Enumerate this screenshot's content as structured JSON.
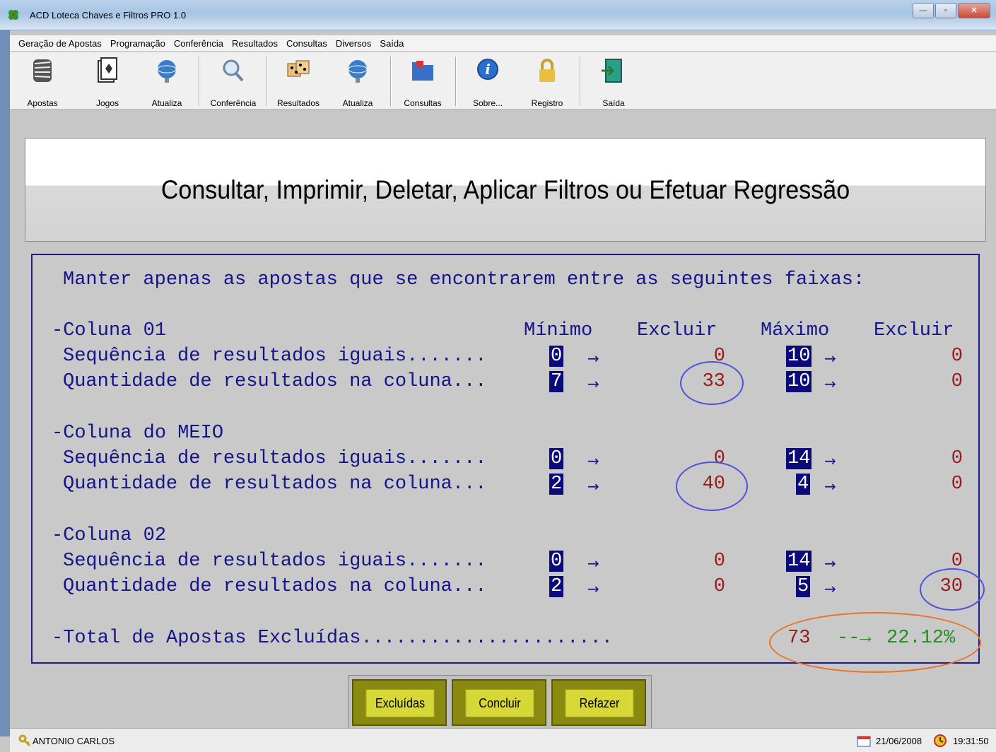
{
  "window": {
    "title": "ACD Loteca Chaves e Filtros PRO 1.0"
  },
  "menu": [
    "Geração de Apostas",
    "Programação",
    "Conferência",
    "Resultados",
    "Consultas",
    "Diversos",
    "Saída"
  ],
  "toolbar": {
    "apostas": "Apostas",
    "jogos": "Jogos",
    "atualiza1": "Atualiza",
    "conferencia": "Conferência",
    "resultados": "Resultados",
    "atualiza2": "Atualiza",
    "consultas": "Consultas",
    "sobre": "Sobre...",
    "registro": "Registro",
    "saida": "Saída"
  },
  "header": {
    "title": "Consultar, Imprimir, Deletar, Aplicar Filtros ou Efetuar Regressão"
  },
  "filter": {
    "intro": "Manter apenas as apostas que se encontrarem entre as seguintes faixas:",
    "col_min": "Mínimo",
    "col_excl": "Excluir",
    "col_max": "Máximo",
    "col_excl2": "Excluir",
    "row_seq": "Sequência de resultados iguais.......",
    "row_qty": "Quantidade de resultados na coluna...",
    "sections": [
      {
        "label": "-Coluna 01",
        "seq": {
          "min": "0",
          "excl_min": "0",
          "max": "10",
          "excl_max": "0"
        },
        "qty": {
          "min": "7",
          "excl_min": "33",
          "max": "10",
          "excl_max": "0"
        }
      },
      {
        "label": "-Coluna do MEIO",
        "seq": {
          "min": "0",
          "excl_min": "0",
          "max": "14",
          "excl_max": "0"
        },
        "qty": {
          "min": "2",
          "excl_min": "40",
          "max": "4",
          "excl_max": "0"
        }
      },
      {
        "label": "-Coluna 02",
        "seq": {
          "min": "0",
          "excl_min": "0",
          "max": "14",
          "excl_max": "0"
        },
        "qty": {
          "min": "2",
          "excl_min": "0",
          "max": "5",
          "excl_max": "30"
        }
      }
    ],
    "total_label": "-Total de Apostas Excluídas......................",
    "total_value": "73",
    "total_pct": "22.12%"
  },
  "buttons": {
    "excluidas": "Excluídas",
    "concluir": "Concluir",
    "refazer": "Refazer"
  },
  "status": {
    "user": "ANTONIO CARLOS",
    "date": "21/06/2008",
    "time": "19:31:50"
  },
  "colors": {
    "panel_text": "#14148a",
    "excluded_value": "#9a1a1a",
    "percent": "#1e8f1e",
    "highlight_bg": "#0a0a7a",
    "button_face": "#d7d737"
  }
}
